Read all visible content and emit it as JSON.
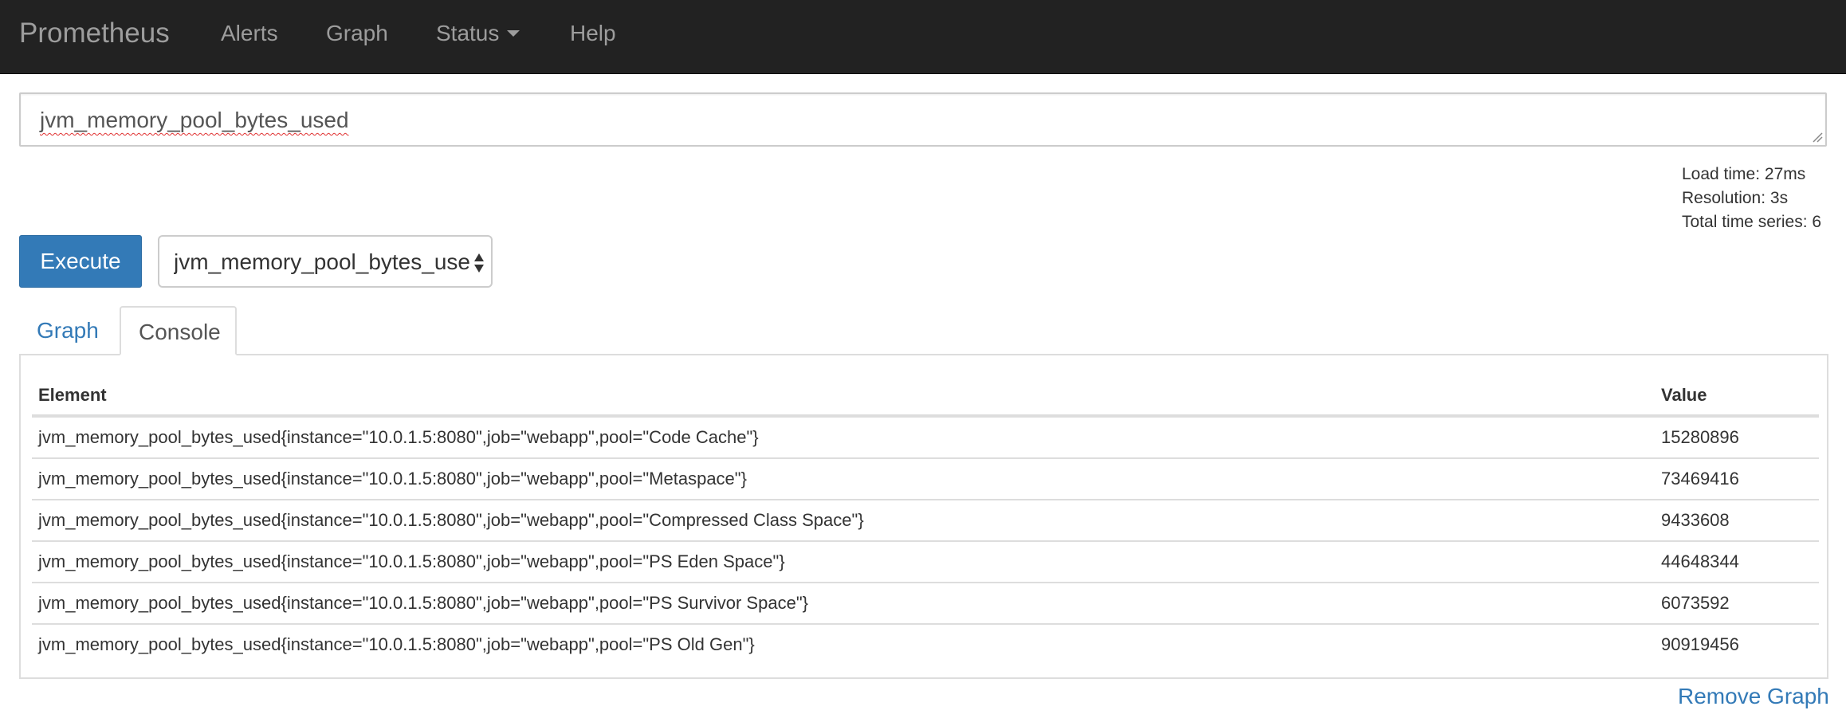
{
  "navbar": {
    "brand": "Prometheus",
    "items": [
      {
        "label": "Alerts"
      },
      {
        "label": "Graph"
      },
      {
        "label": "Status"
      },
      {
        "label": "Help"
      }
    ]
  },
  "query": {
    "expression": "jvm_memory_pool_bytes_used"
  },
  "stats": {
    "load_time": "Load time: 27ms",
    "resolution": "Resolution: 3s",
    "total_series": "Total time series: 6"
  },
  "controls": {
    "execute_label": "Execute",
    "metric_select_value": "jvm_memory_pool_bytes_used"
  },
  "tabs": [
    {
      "label": "Graph",
      "active": false
    },
    {
      "label": "Console",
      "active": true
    }
  ],
  "table": {
    "columns": [
      "Element",
      "Value"
    ],
    "rows": [
      {
        "element": "jvm_memory_pool_bytes_used{instance=\"10.0.1.5:8080\",job=\"webapp\",pool=\"Code Cache\"}",
        "value": "15280896"
      },
      {
        "element": "jvm_memory_pool_bytes_used{instance=\"10.0.1.5:8080\",job=\"webapp\",pool=\"Metaspace\"}",
        "value": "73469416"
      },
      {
        "element": "jvm_memory_pool_bytes_used{instance=\"10.0.1.5:8080\",job=\"webapp\",pool=\"Compressed Class Space\"}",
        "value": "9433608"
      },
      {
        "element": "jvm_memory_pool_bytes_used{instance=\"10.0.1.5:8080\",job=\"webapp\",pool=\"PS Eden Space\"}",
        "value": "44648344"
      },
      {
        "element": "jvm_memory_pool_bytes_used{instance=\"10.0.1.5:8080\",job=\"webapp\",pool=\"PS Survivor Space\"}",
        "value": "6073592"
      },
      {
        "element": "jvm_memory_pool_bytes_used{instance=\"10.0.1.5:8080\",job=\"webapp\",pool=\"PS Old Gen\"}",
        "value": "90919456"
      }
    ]
  },
  "remove_graph_label": "Remove Graph",
  "colors": {
    "navbar_bg": "#222222",
    "nav_text": "#9d9d9d",
    "primary": "#337ab7",
    "border": "#dddddd"
  },
  "icons": {
    "status_dropdown": "caret-down-icon",
    "select_arrows": "sort-arrows-icon",
    "textarea_resize": "resize-grip-icon"
  }
}
